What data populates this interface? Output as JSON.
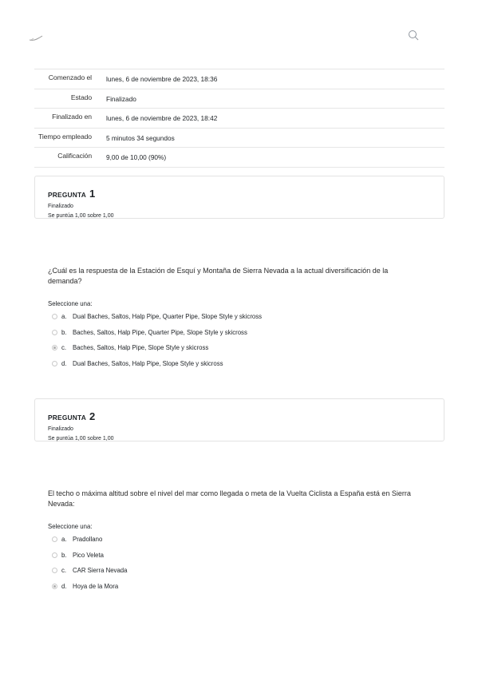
{
  "summary": [
    {
      "label": "Comenzado el",
      "value": "lunes, 6 de noviembre de 2023, 18:36"
    },
    {
      "label": "Estado",
      "value": "Finalizado"
    },
    {
      "label": "Finalizado en",
      "value": "lunes, 6 de noviembre de 2023, 18:42"
    },
    {
      "label": "Tiempo empleado",
      "value": "5 minutos 34 segundos"
    },
    {
      "label": "Calificación",
      "value": "9,00 de 10,00 (90%)"
    }
  ],
  "questions": [
    {
      "label": "PREGUNTA",
      "number": "1",
      "state": "Finalizado",
      "grade": "Se puntúa 1,00 sobre 1,00",
      "text": "¿Cuál es la respuesta de la Estación de Esquí y Montaña de Sierra Nevada a la actual diversificación de la demanda?",
      "prompt": "Seleccione una:",
      "answers": [
        {
          "letter": "a.",
          "text": "Dual Baches, Saltos, Halp Pipe, Quarter Pipe, Slope Style y skicross",
          "selected": false
        },
        {
          "letter": "b.",
          "text": "Baches, Saltos, Halp Pipe, Quarter Pipe, Slope Style y skicross",
          "selected": false
        },
        {
          "letter": "c.",
          "text": "Baches, Saltos, Halp Pipe, Slope Style y skicross",
          "selected": true
        },
        {
          "letter": "d.",
          "text": "Dual Baches, Saltos, Halp Pipe, Slope Style y skicross",
          "selected": false
        }
      ]
    },
    {
      "label": "PREGUNTA",
      "number": "2",
      "state": "Finalizado",
      "grade": "Se puntúa 1,00 sobre 1,00",
      "text": "El techo o máxima altitud sobre el nivel del mar como llegada o meta de la Vuelta Ciclista a España está en Sierra Nevada:",
      "prompt": "Seleccione una:",
      "answers": [
        {
          "letter": "a.",
          "text": "Pradollano",
          "selected": false
        },
        {
          "letter": "b.",
          "text": "Pico Veleta",
          "selected": false
        },
        {
          "letter": "c.",
          "text": "CAR Sierra Nevada",
          "selected": false
        },
        {
          "letter": "d.",
          "text": "Hoya de la Mora",
          "selected": true
        }
      ]
    }
  ],
  "icons": {
    "logo": "site-logo",
    "search": "search-icon"
  }
}
